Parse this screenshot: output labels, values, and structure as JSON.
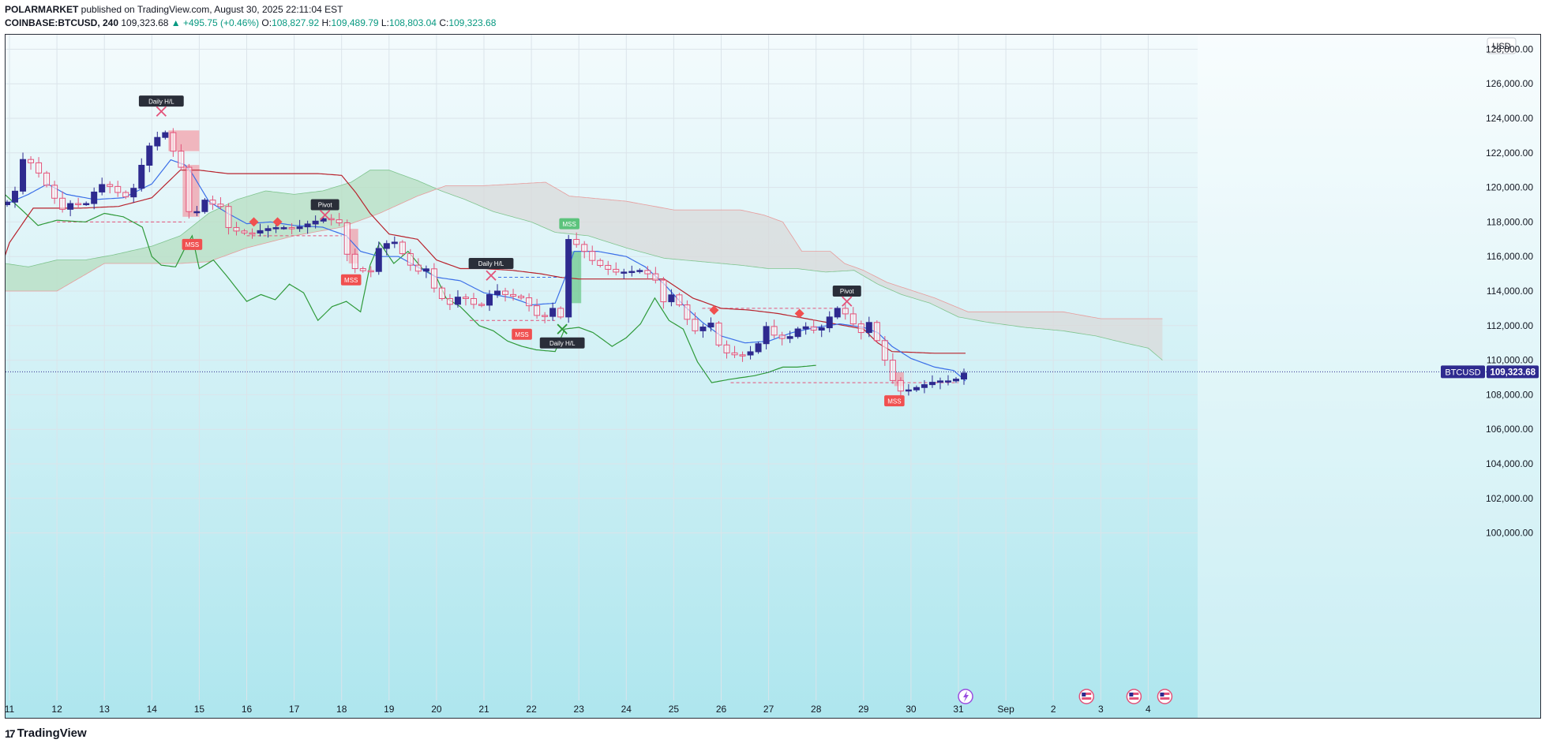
{
  "header": {
    "author": "POLARMARKET",
    "published": "published on TradingView.com, August 30, 2025 22:11:04 EST",
    "symbol": "COINBASE:BTCUSD, 240",
    "last": "109,323.68",
    "change": "▲ +495.75 (+0.46%)",
    "o_label": "O:",
    "o": "108,827.92",
    "h_label": "H:",
    "h": "109,489.79",
    "l_label": "L:",
    "l": "108,803.04",
    "c_label": "C:",
    "c": "109,323.68"
  },
  "footer": {
    "brand": "TradingView",
    "logo_icon": "tradingview-logo-icon"
  },
  "colors": {
    "bg_top": "#f4fbfd",
    "bg_bottom": "#aee6ee",
    "bull": "#2e2a8f",
    "bear": "#e3537a",
    "fast_line": "#3b6fe8",
    "slow_line": "#b8232d",
    "lag_line": "#2f9a3a",
    "cloud_green": "#b5dec0",
    "cloud_gray": "#d9d9d9",
    "ob_red": "#f58a96",
    "ob_green": "#5cc37c",
    "mss": "#f05050",
    "badge_dark": "#2a2e39",
    "price_label": "#2e2a8f"
  },
  "chart_data": {
    "type": "candlestick",
    "ylim": [
      98500,
      129000
    ],
    "price_unit": "USD",
    "y_ticks": [
      100000,
      102000,
      104000,
      106000,
      108000,
      110000,
      112000,
      114000,
      116000,
      118000,
      120000,
      122000,
      124000,
      126000,
      128000
    ],
    "y_tick_labels": [
      "100,000.00",
      "102,000.00",
      "104,000.00",
      "106,000.00",
      "108,000.00",
      "110,000.00",
      "112,000.00",
      "114,000.00",
      "116,000.00",
      "118,000.00",
      "120,000.00",
      "122,000.00",
      "124,000.00",
      "126,000.00",
      "128,000.00"
    ],
    "x_ticks": [
      {
        "day": 11,
        "label": "11"
      },
      {
        "day": 12,
        "label": "12"
      },
      {
        "day": 13,
        "label": "13"
      },
      {
        "day": 14,
        "label": "14"
      },
      {
        "day": 15,
        "label": "15"
      },
      {
        "day": 16,
        "label": "16"
      },
      {
        "day": 17,
        "label": "17"
      },
      {
        "day": 18,
        "label": "18"
      },
      {
        "day": 19,
        "label": "19"
      },
      {
        "day": 20,
        "label": "20"
      },
      {
        "day": 21,
        "label": "21"
      },
      {
        "day": 22,
        "label": "22"
      },
      {
        "day": 23,
        "label": "23"
      },
      {
        "day": 24,
        "label": "24"
      },
      {
        "day": 25,
        "label": "25"
      },
      {
        "day": 26,
        "label": "26"
      },
      {
        "day": 27,
        "label": "27"
      },
      {
        "day": 28,
        "label": "28"
      },
      {
        "day": 29,
        "label": "29"
      },
      {
        "day": 30,
        "label": "30"
      },
      {
        "day": 31,
        "label": "31"
      },
      {
        "day": 32,
        "label": "Sep"
      },
      {
        "day": 33,
        "label": "2"
      },
      {
        "day": 34,
        "label": "3"
      },
      {
        "day": 35,
        "label": "4"
      }
    ],
    "xlim": [
      11,
      36.7
    ],
    "last_price": 109323.68,
    "last_price_label": "109,323.68",
    "symbol_label": "BTCUSD",
    "close_keyframes": [
      [
        10.9,
        119000
      ],
      [
        11.1,
        119600
      ],
      [
        11.3,
        121800
      ],
      [
        11.5,
        121300
      ],
      [
        11.7,
        120500
      ],
      [
        11.9,
        119600
      ],
      [
        12.1,
        118700
      ],
      [
        12.3,
        119100
      ],
      [
        12.6,
        119000
      ],
      [
        12.9,
        120200
      ],
      [
        13.2,
        120000
      ],
      [
        13.4,
        119300
      ],
      [
        13.7,
        120200
      ],
      [
        13.8,
        121500
      ],
      [
        14.0,
        122700
      ],
      [
        14.3,
        123200
      ],
      [
        14.45,
        122100
      ],
      [
        14.6,
        121400
      ],
      [
        14.65,
        120700
      ],
      [
        14.75,
        119000
      ],
      [
        14.85,
        117800
      ],
      [
        15.05,
        119400
      ],
      [
        15.2,
        119100
      ],
      [
        15.45,
        118900
      ],
      [
        15.6,
        117700
      ],
      [
        15.75,
        117500
      ],
      [
        16.05,
        117300
      ],
      [
        16.4,
        117600
      ],
      [
        16.7,
        117700
      ],
      [
        17.0,
        117600
      ],
      [
        17.3,
        117900
      ],
      [
        17.6,
        118200
      ],
      [
        17.85,
        118100
      ],
      [
        18.05,
        117800
      ],
      [
        18.15,
        115300
      ],
      [
        18.35,
        115300
      ],
      [
        18.6,
        115000
      ],
      [
        18.8,
        116600
      ],
      [
        19.1,
        116900
      ],
      [
        19.35,
        115900
      ],
      [
        19.55,
        115100
      ],
      [
        19.8,
        115300
      ],
      [
        20.0,
        113800
      ],
      [
        20.3,
        113200
      ],
      [
        20.5,
        113800
      ],
      [
        20.9,
        113000
      ],
      [
        21.2,
        114100
      ],
      [
        21.45,
        113800
      ],
      [
        21.8,
        113600
      ],
      [
        22.0,
        113000
      ],
      [
        22.2,
        112300
      ],
      [
        22.45,
        113000
      ],
      [
        22.65,
        112400
      ],
      [
        22.75,
        117100
      ],
      [
        22.9,
        116600
      ],
      [
        23.05,
        116900
      ],
      [
        23.15,
        116000
      ],
      [
        23.5,
        115400
      ],
      [
        23.75,
        115100
      ],
      [
        24.0,
        115100
      ],
      [
        24.3,
        115200
      ],
      [
        24.6,
        114800
      ],
      [
        24.75,
        113300
      ],
      [
        25.0,
        113900
      ],
      [
        25.2,
        112700
      ],
      [
        25.5,
        111500
      ],
      [
        25.75,
        112400
      ],
      [
        26.0,
        110500
      ],
      [
        26.3,
        110300
      ],
      [
        26.55,
        110300
      ],
      [
        26.8,
        111000
      ],
      [
        26.9,
        112100
      ],
      [
        27.2,
        111200
      ],
      [
        27.5,
        111400
      ],
      [
        27.7,
        112100
      ],
      [
        27.9,
        111700
      ],
      [
        28.15,
        111900
      ],
      [
        28.35,
        112800
      ],
      [
        28.5,
        113100
      ],
      [
        28.75,
        112200
      ],
      [
        28.95,
        111600
      ],
      [
        29.15,
        112300
      ],
      [
        29.25,
        111800
      ],
      [
        29.35,
        109800
      ],
      [
        29.5,
        110100
      ],
      [
        29.6,
        108900
      ],
      [
        29.75,
        108200
      ],
      [
        30.0,
        108300
      ],
      [
        30.3,
        108600
      ],
      [
        30.55,
        108800
      ],
      [
        30.9,
        108800
      ],
      [
        31.15,
        109323.68
      ]
    ],
    "ichimoku_span_a_keyframes": [
      [
        10.9,
        115600
      ],
      [
        11.4,
        115400
      ],
      [
        12.0,
        115800
      ],
      [
        12.6,
        115800
      ],
      [
        13.2,
        116100
      ],
      [
        14.0,
        116600
      ],
      [
        14.6,
        117200
      ],
      [
        15.2,
        118500
      ],
      [
        15.8,
        119300
      ],
      [
        16.4,
        119800
      ],
      [
        17.0,
        119600
      ],
      [
        17.6,
        119800
      ],
      [
        18.2,
        120300
      ],
      [
        18.6,
        121000
      ],
      [
        19.0,
        121000
      ],
      [
        19.6,
        120400
      ],
      [
        20.1,
        119800
      ],
      [
        20.6,
        119300
      ],
      [
        21.2,
        118600
      ],
      [
        22.0,
        118000
      ],
      [
        22.5,
        117400
      ],
      [
        23.2,
        117200
      ],
      [
        24.0,
        116500
      ],
      [
        24.8,
        115900
      ],
      [
        25.6,
        115700
      ],
      [
        26.4,
        115500
      ],
      [
        27.0,
        115300
      ],
      [
        27.6,
        115300
      ],
      [
        28.2,
        115100
      ],
      [
        28.8,
        115200
      ],
      [
        29.3,
        114400
      ],
      [
        29.8,
        113800
      ],
      [
        30.4,
        113300
      ],
      [
        31.0,
        112500
      ],
      [
        31.6,
        112200
      ],
      [
        32.4,
        111900
      ],
      [
        33.2,
        111700
      ],
      [
        33.9,
        111400
      ],
      [
        34.5,
        111000
      ],
      [
        35.0,
        110700
      ],
      [
        35.3,
        110000
      ]
    ],
    "ichimoku_span_b_keyframes": [
      [
        10.9,
        114000
      ],
      [
        12.0,
        114000
      ],
      [
        13.0,
        115600
      ],
      [
        14.0,
        115600
      ],
      [
        14.6,
        115600
      ],
      [
        15.2,
        115700
      ],
      [
        16.0,
        116500
      ],
      [
        17.0,
        117200
      ],
      [
        18.0,
        117700
      ],
      [
        18.8,
        118500
      ],
      [
        19.6,
        119500
      ],
      [
        20.2,
        120100
      ],
      [
        21.0,
        120100
      ],
      [
        22.3,
        120300
      ],
      [
        22.8,
        119500
      ],
      [
        24.0,
        119200
      ],
      [
        25.0,
        118700
      ],
      [
        25.6,
        118700
      ],
      [
        26.4,
        118700
      ],
      [
        26.9,
        118400
      ],
      [
        27.3,
        118000
      ],
      [
        27.7,
        116300
      ],
      [
        28.3,
        116300
      ],
      [
        28.6,
        115600
      ],
      [
        29.0,
        115200
      ],
      [
        29.5,
        114500
      ],
      [
        30.5,
        113600
      ],
      [
        31.2,
        112800
      ],
      [
        32.2,
        112800
      ],
      [
        33.2,
        112800
      ],
      [
        34.0,
        112400
      ],
      [
        35.0,
        112400
      ],
      [
        35.3,
        112400
      ]
    ],
    "tenkan_keyframes": [
      [
        10.9,
        119000
      ],
      [
        11.4,
        119600
      ],
      [
        11.8,
        120200
      ],
      [
        12.2,
        119600
      ],
      [
        12.8,
        119300
      ],
      [
        13.4,
        119400
      ],
      [
        14.0,
        120200
      ],
      [
        14.4,
        121600
      ],
      [
        14.7,
        121300
      ],
      [
        14.85,
        120800
      ],
      [
        15.2,
        119200
      ],
      [
        15.6,
        118500
      ],
      [
        16.0,
        117900
      ],
      [
        16.5,
        118000
      ],
      [
        17.0,
        117800
      ],
      [
        17.6,
        117700
      ],
      [
        18.1,
        117200
      ],
      [
        18.4,
        116300
      ],
      [
        18.8,
        116000
      ],
      [
        19.2,
        116000
      ],
      [
        19.6,
        115400
      ],
      [
        20.0,
        114800
      ],
      [
        20.5,
        114600
      ],
      [
        21.0,
        113900
      ],
      [
        21.6,
        113600
      ],
      [
        22.0,
        113200
      ],
      [
        22.5,
        113300
      ],
      [
        22.7,
        114700
      ],
      [
        22.9,
        116300
      ],
      [
        23.4,
        116300
      ],
      [
        24.0,
        116000
      ],
      [
        24.4,
        115400
      ],
      [
        24.8,
        114400
      ],
      [
        25.2,
        113200
      ],
      [
        25.6,
        112200
      ],
      [
        26.0,
        111400
      ],
      [
        26.5,
        111000
      ],
      [
        27.0,
        111100
      ],
      [
        27.5,
        111600
      ],
      [
        28.0,
        111900
      ],
      [
        28.5,
        112100
      ],
      [
        29.0,
        111900
      ],
      [
        29.3,
        111600
      ],
      [
        29.6,
        110800
      ],
      [
        30.0,
        110100
      ],
      [
        30.5,
        109600
      ],
      [
        30.9,
        109400
      ],
      [
        31.15,
        108800
      ]
    ],
    "kijun_keyframes": [
      [
        10.9,
        116000
      ],
      [
        11.0,
        116800
      ],
      [
        11.5,
        118800
      ],
      [
        12.5,
        118800
      ],
      [
        13.3,
        118900
      ],
      [
        14.0,
        119400
      ],
      [
        14.6,
        121000
      ],
      [
        15.0,
        121000
      ],
      [
        15.6,
        120800
      ],
      [
        16.5,
        120800
      ],
      [
        17.5,
        120800
      ],
      [
        18.0,
        120700
      ],
      [
        18.3,
        119700
      ],
      [
        18.6,
        118500
      ],
      [
        19.0,
        117300
      ],
      [
        19.6,
        117000
      ],
      [
        20.0,
        115800
      ],
      [
        20.5,
        115300
      ],
      [
        21.0,
        115300
      ],
      [
        21.6,
        115200
      ],
      [
        22.2,
        115000
      ],
      [
        22.6,
        114800
      ],
      [
        23.0,
        114700
      ],
      [
        24.0,
        114700
      ],
      [
        24.8,
        114700
      ],
      [
        25.4,
        113600
      ],
      [
        26.0,
        113000
      ],
      [
        26.6,
        112900
      ],
      [
        27.2,
        112700
      ],
      [
        28.0,
        112300
      ],
      [
        28.6,
        112000
      ],
      [
        29.0,
        111800
      ],
      [
        29.3,
        111000
      ],
      [
        29.6,
        110500
      ],
      [
        30.5,
        110400
      ],
      [
        31.15,
        110400
      ]
    ],
    "chikou_keyframes": [
      [
        10.9,
        119600
      ],
      [
        11.3,
        118600
      ],
      [
        11.6,
        117800
      ],
      [
        12.0,
        118100
      ],
      [
        12.6,
        118000
      ],
      [
        13.0,
        118500
      ],
      [
        13.4,
        118300
      ],
      [
        13.8,
        117700
      ],
      [
        14.0,
        116000
      ],
      [
        14.2,
        115500
      ],
      [
        14.5,
        115400
      ],
      [
        14.7,
        116500
      ],
      [
        14.85,
        117200
      ],
      [
        15.0,
        115300
      ],
      [
        15.3,
        115800
      ],
      [
        15.6,
        114800
      ],
      [
        16.0,
        113400
      ],
      [
        16.3,
        113800
      ],
      [
        16.6,
        113500
      ],
      [
        16.9,
        114400
      ],
      [
        17.2,
        113900
      ],
      [
        17.5,
        112300
      ],
      [
        17.8,
        113100
      ],
      [
        18.1,
        113400
      ],
      [
        18.4,
        112800
      ],
      [
        18.6,
        115500
      ],
      [
        18.8,
        116800
      ],
      [
        19.1,
        115600
      ],
      [
        19.4,
        116300
      ],
      [
        19.7,
        115300
      ],
      [
        20.0,
        114800
      ],
      [
        20.2,
        113600
      ],
      [
        20.5,
        113100
      ],
      [
        20.9,
        112000
      ],
      [
        21.2,
        111700
      ],
      [
        21.5,
        111100
      ],
      [
        21.8,
        110800
      ],
      [
        22.1,
        110600
      ],
      [
        22.5,
        110500
      ],
      [
        22.7,
        111800
      ],
      [
        23.0,
        111900
      ],
      [
        23.3,
        111600
      ],
      [
        23.7,
        110800
      ],
      [
        24.0,
        111300
      ],
      [
        24.3,
        112100
      ],
      [
        24.6,
        113600
      ],
      [
        24.9,
        112300
      ],
      [
        25.2,
        111800
      ],
      [
        25.5,
        109900
      ],
      [
        25.8,
        108700
      ],
      [
        26.2,
        108900
      ],
      [
        26.7,
        109100
      ],
      [
        27.0,
        109300
      ],
      [
        27.3,
        109600
      ],
      [
        27.6,
        109600
      ],
      [
        28.0,
        109700
      ]
    ]
  },
  "annotations": {
    "daily_hl": "Daily H/L",
    "pivot": "Pivot",
    "mss": "MSS",
    "events_icon": "lightning-bolt-icon",
    "flag_icon": "us-flag-icon"
  }
}
